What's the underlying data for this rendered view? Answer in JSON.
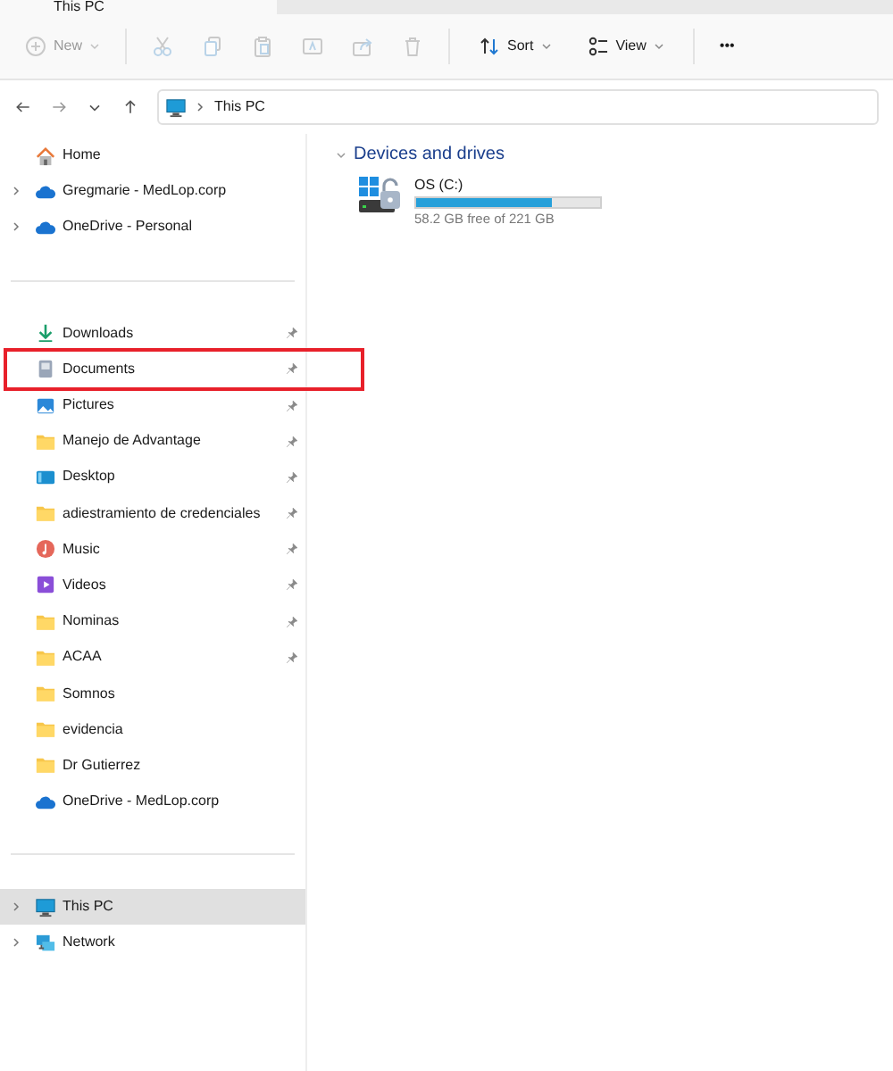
{
  "tab": {
    "title": "This PC"
  },
  "toolbar": [
    {
      "kind": "new",
      "label": "New",
      "disabled": true
    },
    {
      "kind": "cut",
      "disabled": true
    },
    {
      "kind": "copy",
      "disabled": true
    },
    {
      "kind": "paste",
      "disabled": true
    },
    {
      "kind": "rename",
      "disabled": true
    },
    {
      "kind": "share",
      "disabled": true
    },
    {
      "kind": "delete",
      "disabled": true
    },
    {
      "kind": "sort",
      "label": "Sort",
      "disabled": false
    },
    {
      "kind": "view",
      "label": "View",
      "disabled": false
    },
    {
      "kind": "more",
      "label": "•••",
      "disabled": false
    }
  ],
  "address": {
    "path": "This PC"
  },
  "sidebar": {
    "groups": [
      [
        {
          "label": "Home",
          "kind": "home",
          "expandable": false,
          "pinned": false,
          "selected": false,
          "highlighted": false
        },
        {
          "label": "Gregmarie - MedLop.corp",
          "kind": "cloud",
          "expandable": true,
          "pinned": false,
          "selected": false,
          "highlighted": false
        },
        {
          "label": "OneDrive - Personal",
          "kind": "cloud",
          "expandable": true,
          "pinned": false,
          "selected": false,
          "highlighted": false
        }
      ],
      [
        {
          "label": "Downloads",
          "kind": "download",
          "expandable": false,
          "pinned": true,
          "selected": false,
          "highlighted": false
        },
        {
          "label": "Documents",
          "kind": "document",
          "expandable": false,
          "pinned": true,
          "selected": false,
          "highlighted": true
        },
        {
          "label": "Pictures",
          "kind": "pictures",
          "expandable": false,
          "pinned": true,
          "selected": false,
          "highlighted": false
        },
        {
          "label": "Manejo de Advantage",
          "kind": "folder",
          "expandable": false,
          "pinned": true,
          "selected": false,
          "highlighted": false
        },
        {
          "label": "Desktop",
          "kind": "desktop",
          "expandable": false,
          "pinned": true,
          "selected": false,
          "highlighted": false
        },
        {
          "label": "adiestramiento de credenciales",
          "kind": "folder",
          "expandable": false,
          "pinned": true,
          "selected": false,
          "highlighted": false
        },
        {
          "label": "Music",
          "kind": "music",
          "expandable": false,
          "pinned": true,
          "selected": false,
          "highlighted": false
        },
        {
          "label": "Videos",
          "kind": "videos",
          "expandable": false,
          "pinned": true,
          "selected": false,
          "highlighted": false
        },
        {
          "label": "Nominas",
          "kind": "folder",
          "expandable": false,
          "pinned": true,
          "selected": false,
          "highlighted": false
        },
        {
          "label": "ACAA",
          "kind": "folder",
          "expandable": false,
          "pinned": true,
          "selected": false,
          "highlighted": false
        },
        {
          "label": "Somnos",
          "kind": "folder",
          "expandable": false,
          "pinned": false,
          "selected": false,
          "highlighted": false
        },
        {
          "label": "evidencia",
          "kind": "folder",
          "expandable": false,
          "pinned": false,
          "selected": false,
          "highlighted": false
        },
        {
          "label": "Dr Gutierrez",
          "kind": "folder",
          "expandable": false,
          "pinned": false,
          "selected": false,
          "highlighted": false
        },
        {
          "label": "OneDrive - MedLop.corp",
          "kind": "cloud",
          "expandable": false,
          "pinned": false,
          "selected": false,
          "highlighted": false
        }
      ],
      [
        {
          "label": "This PC",
          "kind": "pc",
          "expandable": true,
          "pinned": false,
          "selected": true,
          "highlighted": false
        },
        {
          "label": "Network",
          "kind": "network",
          "expandable": true,
          "pinned": false,
          "selected": false,
          "highlighted": false
        }
      ]
    ]
  },
  "content": {
    "section": "Devices and drives",
    "drives": [
      {
        "name": "OS (C:)",
        "level": 0.737,
        "reading": "58.2 GB free of 221 GB"
      }
    ]
  }
}
